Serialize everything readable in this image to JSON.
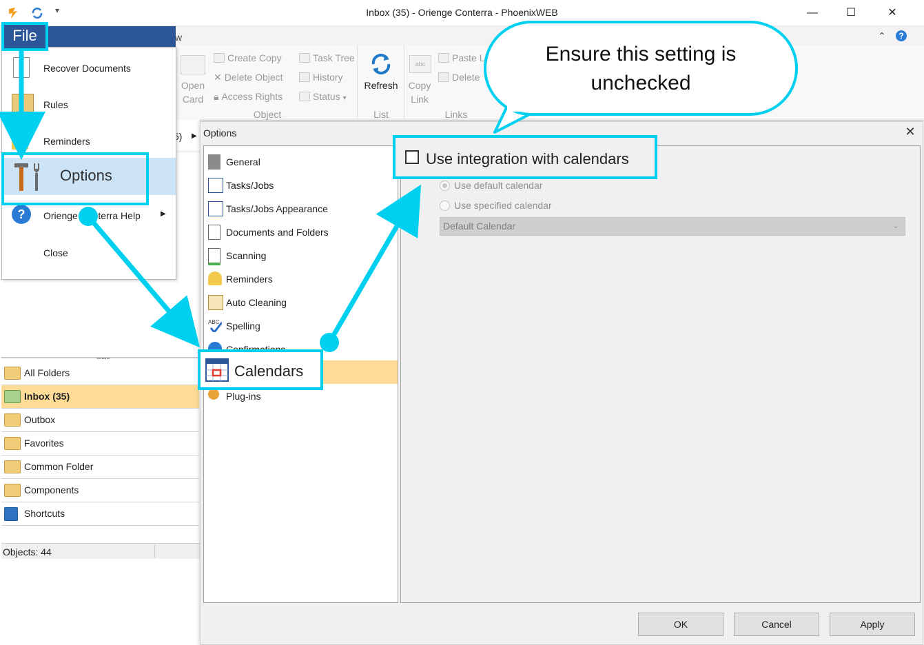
{
  "window": {
    "title": "Inbox (35) - Oriengе Conterra - PhoenixWEB",
    "minimize": "—",
    "maximize": "☐",
    "close": "✕"
  },
  "ribbon": {
    "tab_partial": "w",
    "open_card": [
      "Open",
      "Card"
    ],
    "create_copy": "Create Copy",
    "delete_object": "Delete Object",
    "access_rights": "Access Rights",
    "task_tree": "Task Tree",
    "history": "History",
    "status": "Status",
    "object_group": "Object",
    "refresh": "Refresh",
    "list_group": "List",
    "copy_link": [
      "Copy",
      "Link"
    ],
    "paste_link": "Paste Li",
    "delete": "Delete",
    "links_group": "Links",
    "collapse": "⌃",
    "help": "?"
  },
  "file_menu": {
    "file_label": "File",
    "items": [
      {
        "label": "Recover Documents"
      },
      {
        "label": "Rules"
      },
      {
        "label": "Reminders"
      },
      {
        "label": "Options"
      },
      {
        "label": "Oriengе Conterra Help"
      },
      {
        "label": "Close"
      }
    ]
  },
  "behind_fragment": "5)",
  "left_nav": {
    "splitter": "........",
    "items": [
      {
        "label": "All Folders"
      },
      {
        "label": "Inbox (35)"
      },
      {
        "label": "Outbox"
      },
      {
        "label": "Favorites"
      },
      {
        "label": "Common Folder"
      },
      {
        "label": "Components"
      },
      {
        "label": "Shortcuts"
      }
    ],
    "status": "Objects: 44"
  },
  "options_dialog": {
    "title": "Options",
    "close": "✕",
    "categories": [
      {
        "label": "General"
      },
      {
        "label": "Tasks/Jobs"
      },
      {
        "label": "Tasks/Jobs Appearance"
      },
      {
        "label": "Documents and Folders"
      },
      {
        "label": "Scanning"
      },
      {
        "label": "Reminders"
      },
      {
        "label": "Auto Cleaning"
      },
      {
        "label": "Spelling"
      },
      {
        "label": "Confirmations"
      },
      {
        "label": "Calendars"
      },
      {
        "label": "Plug-ins"
      }
    ],
    "use_integration": "Use integration with calendars",
    "use_default": "Use default calendar",
    "use_specified": "Use specified calendar",
    "calendar_value": "Default Calendar",
    "ok": "OK",
    "cancel": "Cancel",
    "apply": "Apply"
  },
  "callout": {
    "line1": "Ensure this setting is",
    "line2": "unchecked"
  },
  "colors": {
    "accent": "#00d0f0",
    "file_blue": "#2b579a",
    "selection": "#fedc97"
  }
}
